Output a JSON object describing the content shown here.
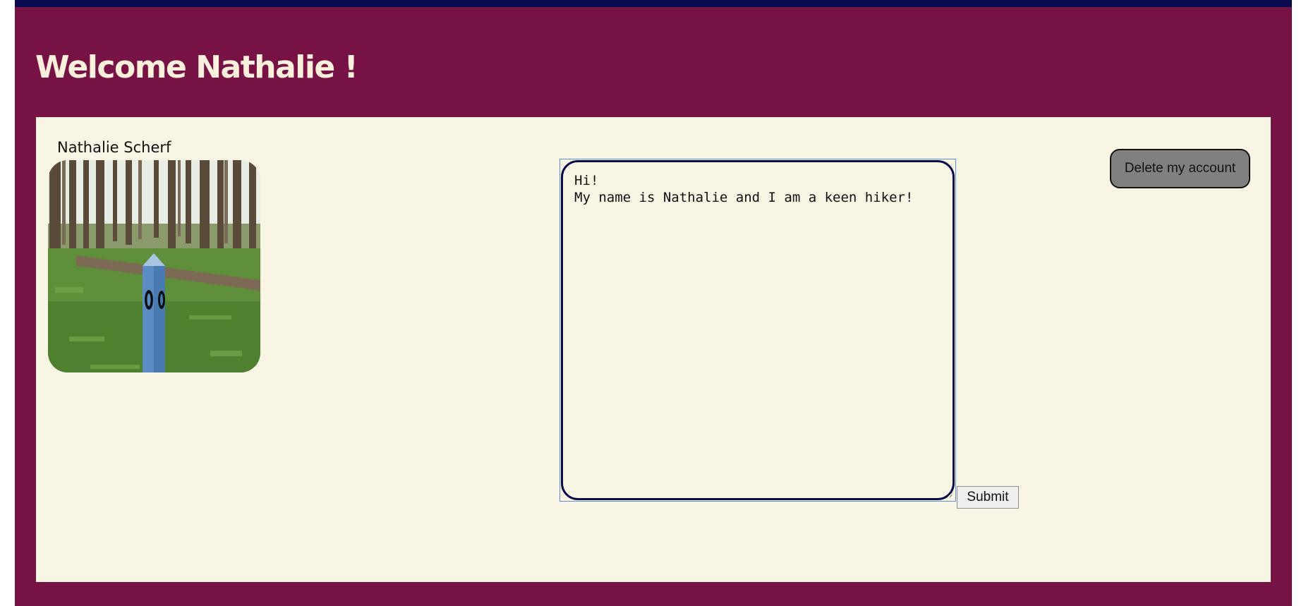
{
  "header": {
    "welcome_text": "Welcome Nathalie !"
  },
  "profile": {
    "name": "Nathalie Scherf",
    "photo_description_icon": "profile-photo"
  },
  "bio": {
    "value": "Hi!\nMy name is Nathalie and I am a keen hiker!"
  },
  "actions": {
    "submit_label": "Submit",
    "delete_label": "Delete my account"
  },
  "colors": {
    "page_background": "#771244",
    "top_bar": "#0a0a4e",
    "panel_background": "#f9f5e5",
    "welcome_text": "#fbf0dc",
    "textarea_border": "#0a0a4e",
    "delete_button": "#808080"
  }
}
